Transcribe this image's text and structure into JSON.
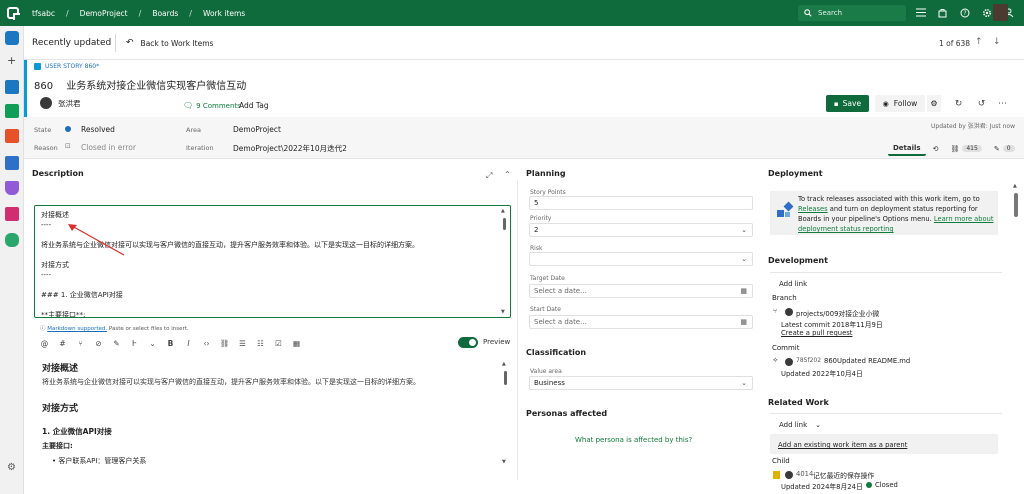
{
  "topbar": {
    "breadcrumbs": [
      "tfsabc",
      "DemoProject",
      "Boards",
      "Work items"
    ],
    "search_label": "Search",
    "brand_color": "#0f6b3b",
    "icons": [
      "list-icon",
      "bag-icon",
      "help-icon",
      "gear-icon",
      "person-settings-icon"
    ]
  },
  "header": {
    "recently_updated": "Recently updated",
    "back_label": "Back to Work Items",
    "pager": "1 of 638"
  },
  "work_item": {
    "kind": "USER STORY 860*",
    "id": "860",
    "title": "业务系统对接企业微信实现客户微信互动",
    "assignee": "张洪君",
    "comments": "9 Comments",
    "add_tag": "Add Tag",
    "save": "Save",
    "follow": "Follow",
    "updated_by": "Updated by 张洪君: Just now"
  },
  "state": {
    "state_label": "State",
    "state_value": "Resolved",
    "reason_label": "Reason",
    "reason_value": "Closed in error",
    "area_label": "Area",
    "area_value": "DemoProject",
    "iteration_label": "Iteration",
    "iteration_value": "DemoProject\\2022年10月迭代2",
    "state_color": "#1a6fbd"
  },
  "tabs": {
    "details": "Details",
    "links_count": "415",
    "attachments_count": "0"
  },
  "description": {
    "title": "Description",
    "editor_lines": [
      "对接概述",
      "----",
      "",
      "将业务系统与企业微信对接可以实现与客户微信的直接互动，提升客户服务效率和体验。以下是实现这一目标的详细方案。",
      "",
      "对接方式",
      "----",
      "",
      "### 1. 企业微信API对接",
      "",
      "**主要接口**:"
    ],
    "md_note_link": "Markdown supported.",
    "md_note_rest": " Paste or select files to insert.",
    "preview_label": "Preview",
    "preview": {
      "h1": "对接概述",
      "p1": "将业务系统与企业微信对接可以实现与客户微信的直接互动，提升客户服务效率和体验。以下是实现这一目标的详细方案。",
      "h2": "对接方式",
      "h3": "1. 企业微信API对接",
      "bold": "主要接口:",
      "li": "客户联系API：管理客户关系"
    }
  },
  "planning": {
    "title": "Planning",
    "story_points_label": "Story Points",
    "story_points": "5",
    "priority_label": "Priority",
    "priority": "2",
    "risk_label": "Risk",
    "risk": "",
    "target_date_label": "Target Date",
    "target_date_ph": "Select a date...",
    "start_date_label": "Start Date",
    "start_date_ph": "Select a date...",
    "classification_title": "Classification",
    "value_area_label": "Value area",
    "value_area": "Business",
    "personas_title": "Personas affected",
    "personas_prompt": "What persona is affected by this?"
  },
  "deployment": {
    "title": "Deployment",
    "text_a": "To track releases associated with this work item, go to ",
    "releases_link": "Releases",
    "text_b": " and turn on deployment status reporting for Boards in your pipeline's Options menu. ",
    "learn_link": "Learn more about deployment status reporting"
  },
  "development": {
    "title": "Development",
    "add_link": "Add link",
    "branch_label": "Branch",
    "branch_name": "projects/009对接企业小微",
    "branch_commit": "Latest commit 2018年11月9日",
    "create_pr": "Create a pull request",
    "commit_label": "Commit",
    "commit_hash": "785f202",
    "commit_msg": "860Updated README.md",
    "commit_date": "Updated 2022年10月4日"
  },
  "related": {
    "title": "Related Work",
    "add_link": "Add link",
    "existing": "Add an existing work item as a parent",
    "child_label": "Child",
    "child_id": "4014",
    "child_title": "记忆最近的保存操作",
    "child_updated": "Updated 2024年8月24日",
    "child_state": "Closed"
  }
}
